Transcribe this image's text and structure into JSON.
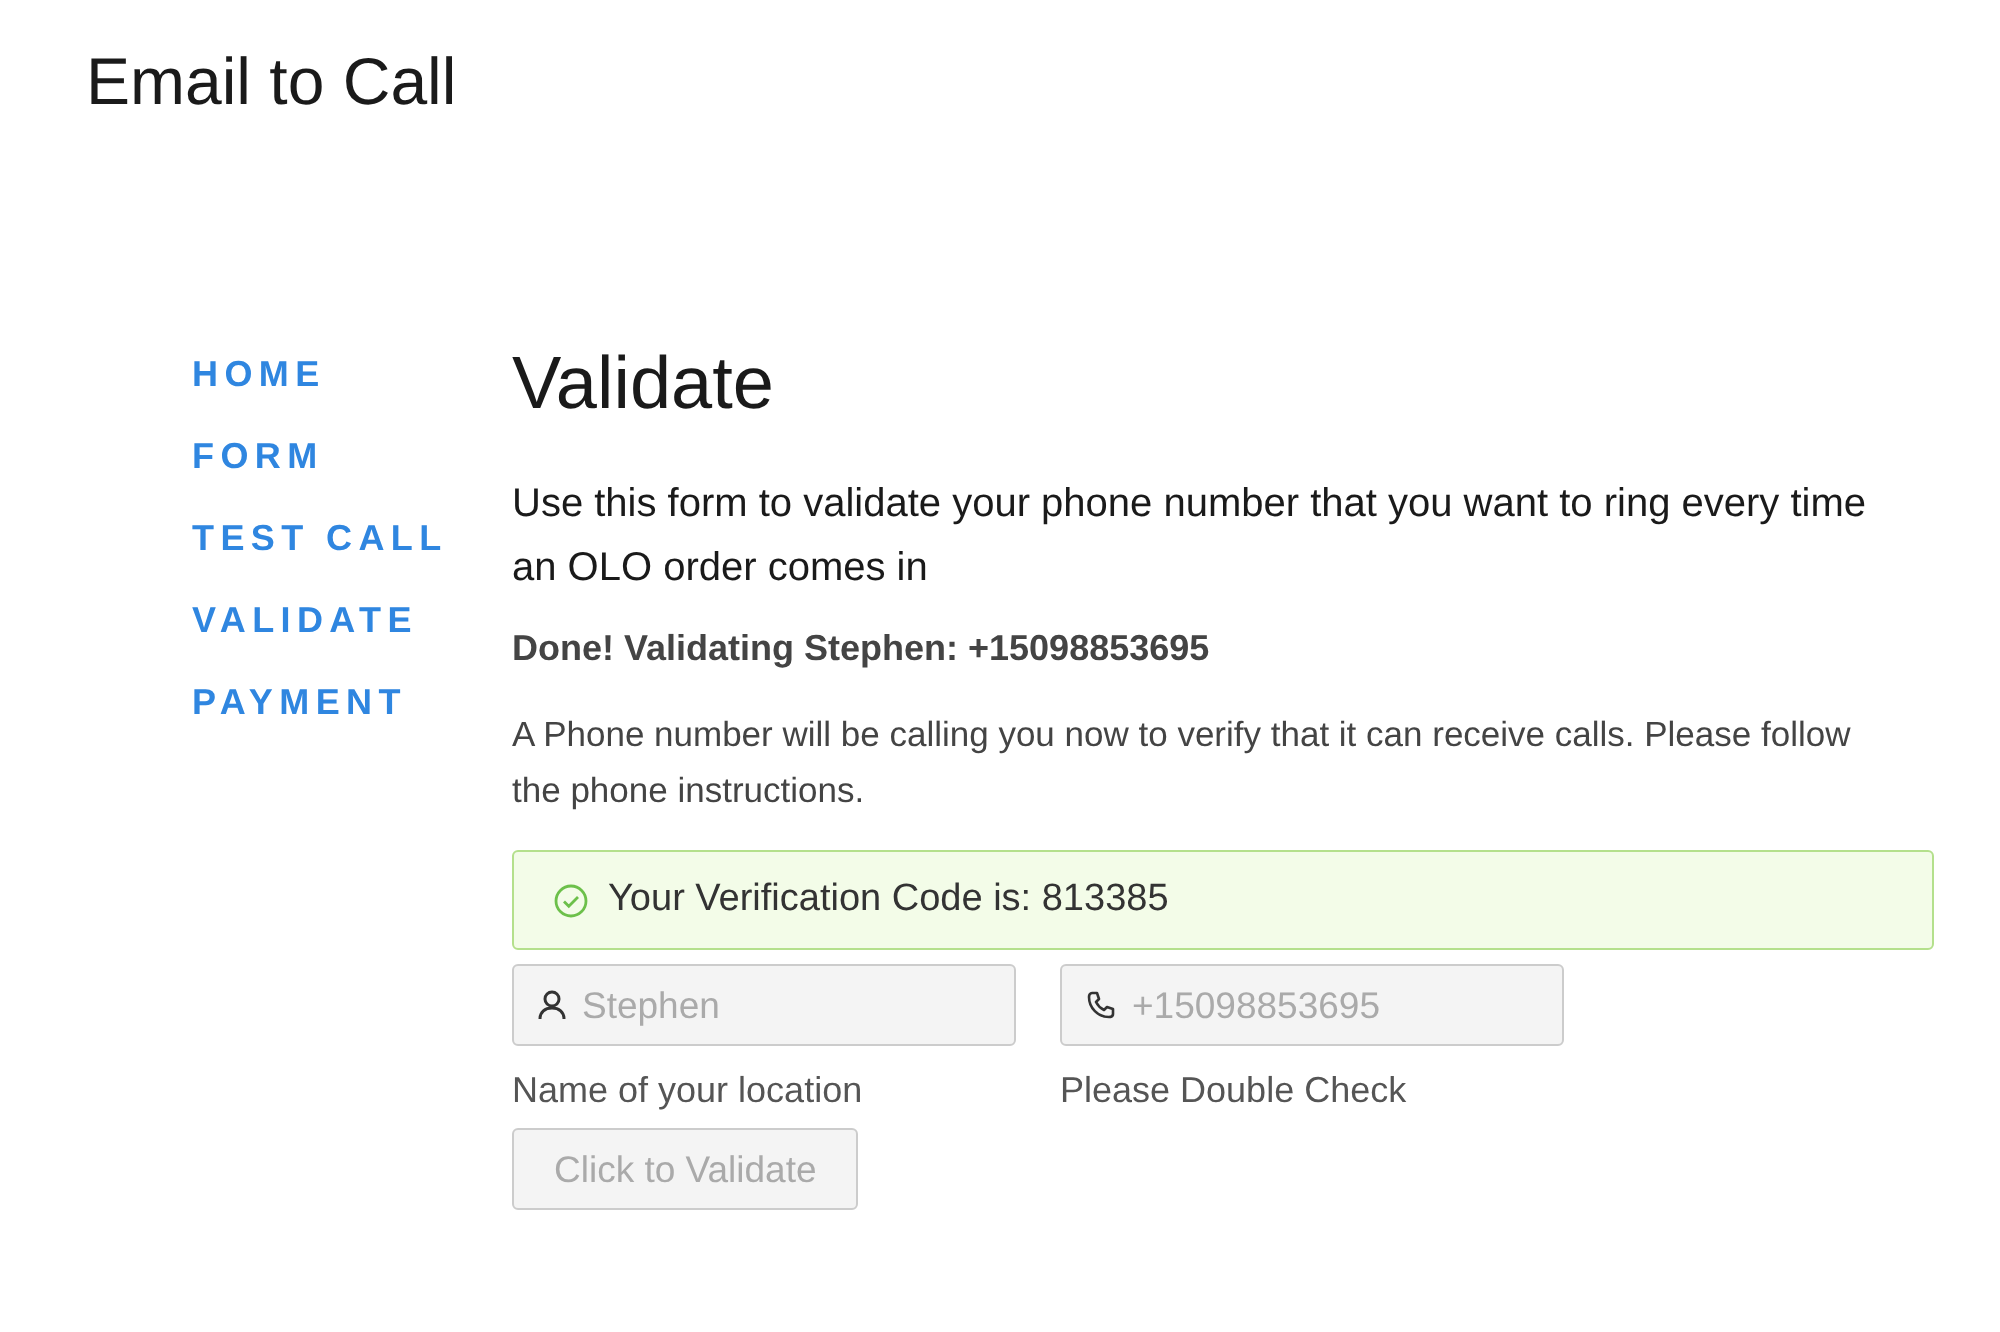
{
  "site_title": "Email to Call",
  "nav": [
    {
      "label": "HOME"
    },
    {
      "label": "FORM"
    },
    {
      "label": "TEST CALL"
    },
    {
      "label": "VALIDATE"
    },
    {
      "label": "PAYMENT"
    }
  ],
  "main": {
    "heading": "Validate",
    "intro": "Use this form to validate your phone number that you want to ring every time an OLO order comes in",
    "status": "Done! Validating Stephen: +15098853695",
    "description": "A Phone number will be calling you now to verify that it can receive calls. Please follow the phone instructions.",
    "alert": {
      "text": "Your Verification Code is: 813385"
    },
    "fields": [
      {
        "kind": "name",
        "value": "Stephen",
        "label": "Name of your location",
        "disabled": true
      },
      {
        "kind": "phone",
        "value": "+15098853695",
        "label": "Please Double Check",
        "disabled": true
      }
    ],
    "button": {
      "label": "Click to Validate",
      "disabled": true
    }
  }
}
